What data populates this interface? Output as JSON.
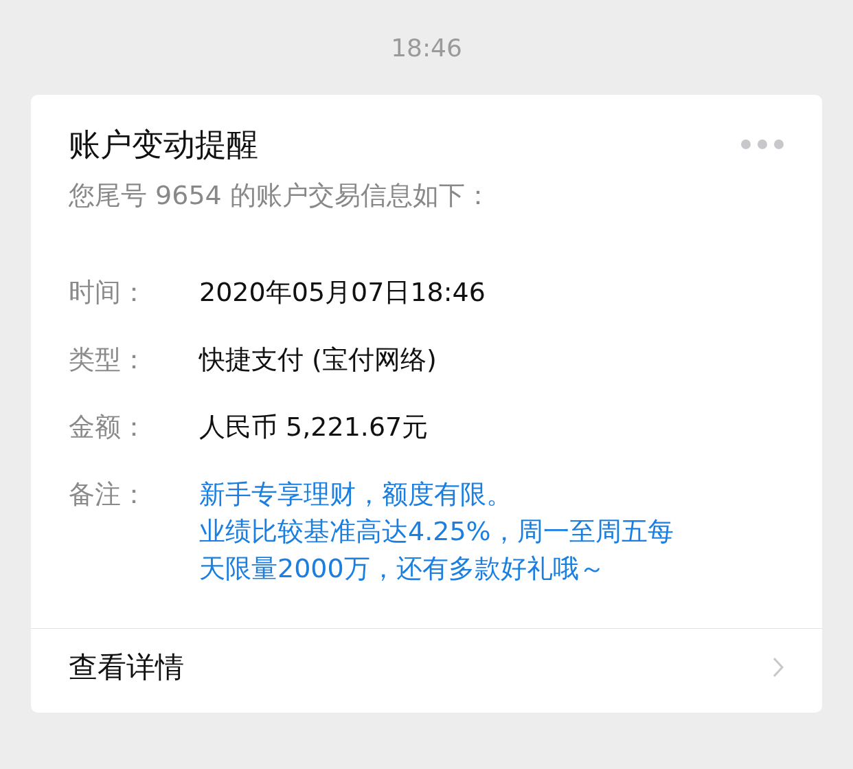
{
  "timestamp": "18:46",
  "card": {
    "title": "账户变动提醒",
    "subtitle": "您尾号 9654 的账户交易信息如下：",
    "fields": [
      {
        "label": "时间：",
        "value": "2020年05月07日18:46",
        "kind": "plain"
      },
      {
        "label": "类型：",
        "value": "快捷支付 (宝付网络)",
        "kind": "plain"
      },
      {
        "label": "金额：",
        "value": "人民币 5,221.67元",
        "kind": "plain"
      },
      {
        "label": "备注：",
        "lines": [
          "新手专享理财，额度有限。",
          "业绩比较基准高达4.25%，周一至周五每",
          "天限量2000万，还有多款好礼哦～"
        ],
        "kind": "highlight"
      }
    ],
    "footer": "查看详情"
  }
}
